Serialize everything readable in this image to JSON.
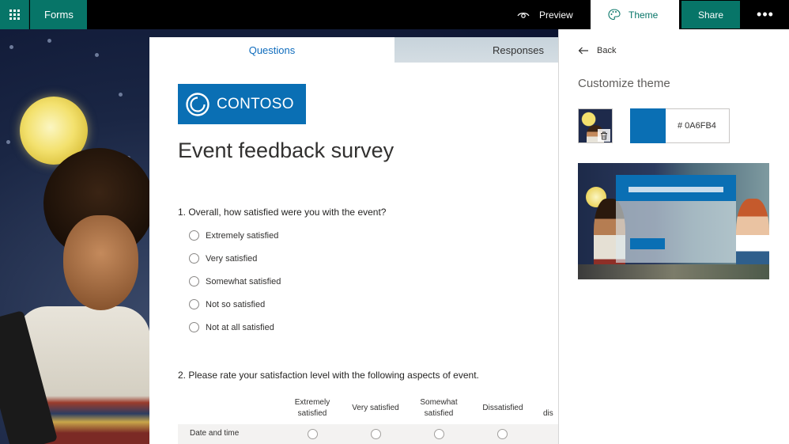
{
  "topbar": {
    "app_name": "Forms",
    "preview_label": "Preview",
    "theme_label": "Theme",
    "share_label": "Share",
    "more_label": "•••",
    "brand_color": "#077568"
  },
  "form": {
    "tabs": [
      {
        "label": "Questions",
        "active": true
      },
      {
        "label": "Responses",
        "active": false
      }
    ],
    "logo_text": "CONTOSO",
    "title": "Event feedback survey",
    "question1": {
      "text": "1. Overall, how satisfied were you with the event?",
      "options": [
        "Extremely satisfied",
        "Very satisfied",
        "Somewhat satisfied",
        "Not so satisfied",
        "Not at all satisfied"
      ]
    },
    "question2": {
      "text": "2. Please rate your satisfaction level with the following aspects of event.",
      "columns": [
        "Extremely satisfied",
        "Very satisfied",
        "Somewhat satisfied",
        "Dissatisfied",
        "dis"
      ],
      "rows": [
        "Date and time"
      ]
    }
  },
  "panel": {
    "back_label": "Back",
    "heading": "Customize theme",
    "hex_value": "# 0A6FB4",
    "theme_color": "#0A6FB4"
  }
}
